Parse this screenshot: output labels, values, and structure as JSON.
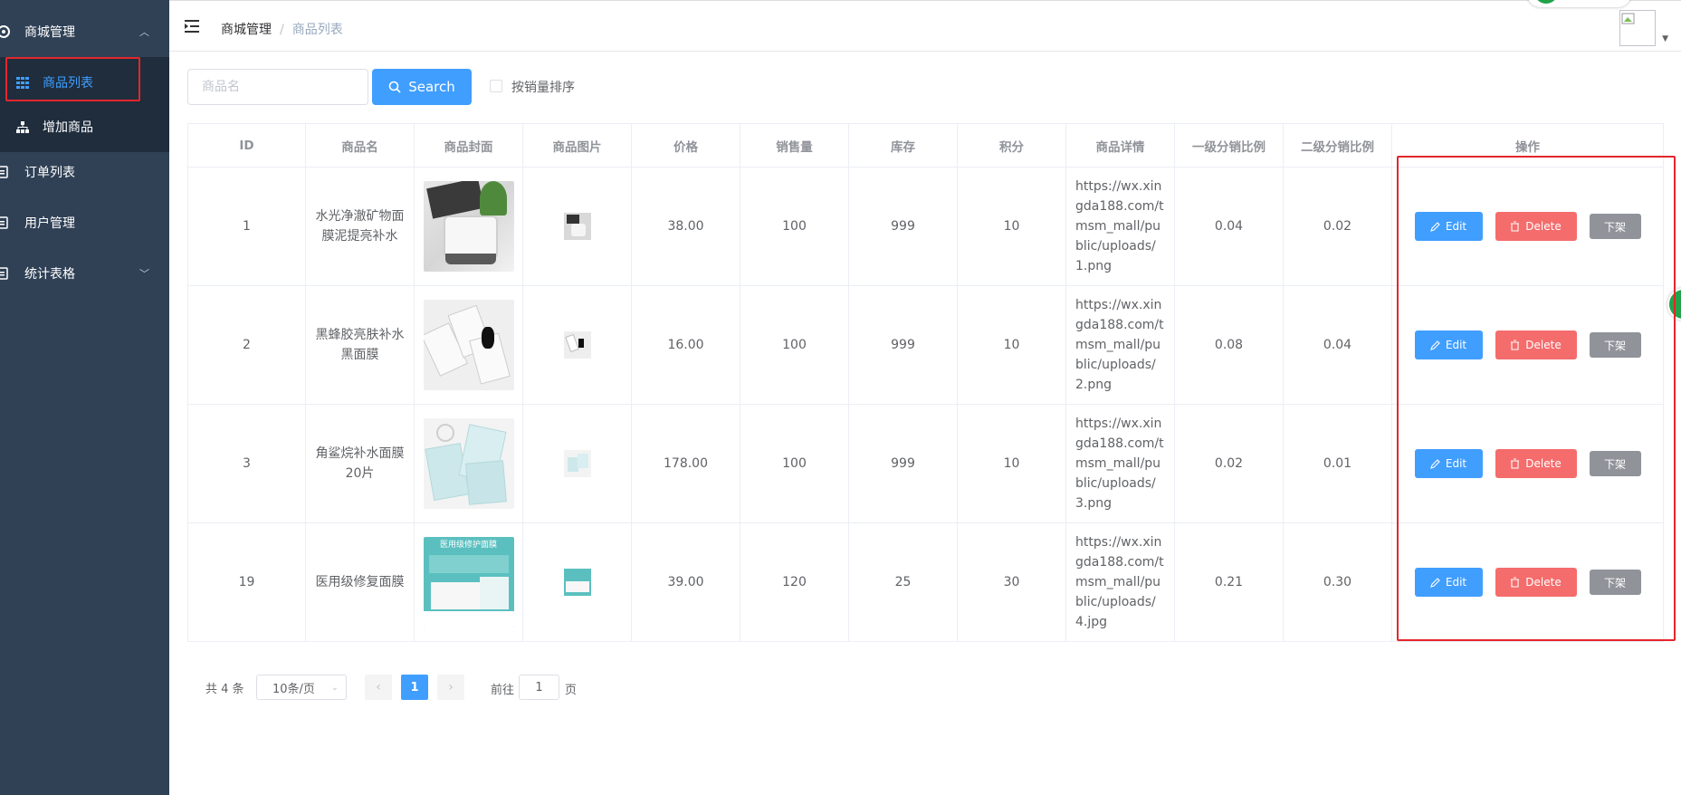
{
  "sidebar": {
    "items": [
      {
        "label": "商城管理",
        "icon": "settings-icon",
        "expanded": true
      },
      {
        "label": "商品列表",
        "icon": "grid-icon",
        "active": true
      },
      {
        "label": "增加商品",
        "icon": "sitemap-icon"
      },
      {
        "label": "订单列表",
        "icon": "document-icon"
      },
      {
        "label": "用户管理",
        "icon": "document-icon"
      },
      {
        "label": "统计表格",
        "icon": "document-icon",
        "expanded": false
      }
    ]
  },
  "header": {
    "breadcrumb": [
      "商城管理",
      "商品列表"
    ],
    "separator": "/"
  },
  "toolbar": {
    "search_placeholder": "商品名",
    "search_label": "Search",
    "sort_label": "按销量排序"
  },
  "table": {
    "columns": [
      "ID",
      "商品名",
      "商品封面",
      "商品图片",
      "价格",
      "销售量",
      "库存",
      "积分",
      "商品详情",
      "一级分销比例",
      "二级分销比例",
      "操作"
    ],
    "rows": [
      {
        "id": "1",
        "name": "水光净澈矿物面膜泥提亮补水",
        "price": "38.00",
        "sales": "100",
        "stock": "999",
        "points": "10",
        "detail": "https://wx.xingda188.com/tmsm_mall/public/uploads/1.png",
        "ratio1": "0.04",
        "ratio2": "0.02"
      },
      {
        "id": "2",
        "name": "黑蜂胶亮肤补水黑面膜",
        "price": "16.00",
        "sales": "100",
        "stock": "999",
        "points": "10",
        "detail": "https://wx.xingda188.com/tmsm_mall/public/uploads/2.png",
        "ratio1": "0.08",
        "ratio2": "0.04"
      },
      {
        "id": "3",
        "name": "角鲨烷补水面膜20片",
        "price": "178.00",
        "sales": "100",
        "stock": "999",
        "points": "10",
        "detail": "https://wx.xingda188.com/tmsm_mall/public/uploads/3.png",
        "ratio1": "0.02",
        "ratio2": "0.01"
      },
      {
        "id": "19",
        "name": "医用级修复面膜",
        "price": "39.00",
        "sales": "120",
        "stock": "25",
        "points": "30",
        "detail": "https://wx.xingda188.com/tmsm_mall/public/uploads/4.jpg",
        "ratio1": "0.21",
        "ratio2": "0.30"
      }
    ],
    "actions": {
      "edit": "Edit",
      "delete": "Delete",
      "off_shelf": "下架"
    },
    "cover4_text": "医用级修护面膜"
  },
  "pagination": {
    "total": "共 4 条",
    "page_size": "10条/页",
    "current_page": "1",
    "goto_prefix": "前往",
    "goto_value": "1",
    "goto_suffix": "页"
  },
  "colors": {
    "sidebar_bg": "#304156",
    "primary": "#409eff",
    "danger": "#f56c6c",
    "info": "#909399",
    "highlight": "#e4262c"
  }
}
